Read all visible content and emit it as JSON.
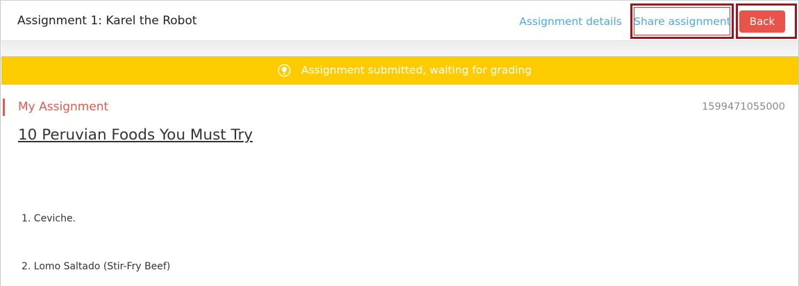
{
  "header": {
    "title": "Assignment 1: Karel the Robot",
    "assignment_details_label": "Assignment details",
    "share_assignment_label": "Share assignment",
    "back_label": "Back"
  },
  "banner": {
    "icon": "lightbulb-icon",
    "message": "Assignment submitted, waiting for grading",
    "color": "#fccc00"
  },
  "content": {
    "section_label": "My Assignment",
    "timestamp": "1599471055000",
    "document_title": "10 Peruvian Foods You Must Try",
    "items": [
      "1. Ceviche.",
      "2. Lomo Saltado (Stir-Fry Beef)"
    ]
  },
  "colors": {
    "accent": "#e05a4e",
    "link": "#4fa7e3",
    "highlight_box": "#a5121c"
  }
}
